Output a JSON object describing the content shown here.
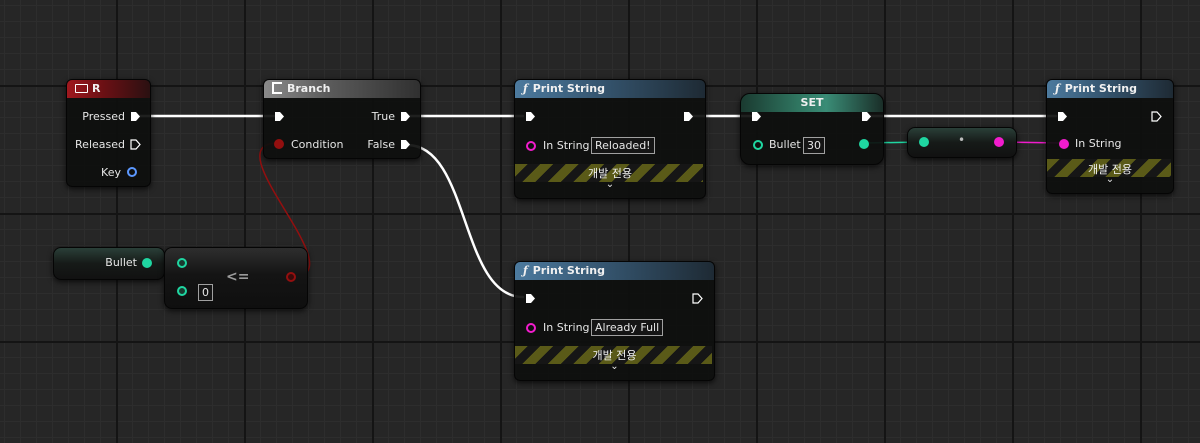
{
  "colors": {
    "exec": "#ffffff",
    "boolean": "#930f0f",
    "integer": "#1fd6a1",
    "string": "#f21ccd",
    "grid": "#262626"
  },
  "icons": {
    "key_event": "keyboard-icon",
    "branch": "branch-icon",
    "function": "function-icon",
    "exec_pin": "exec-pin-icon",
    "data_pin": "data-pin-icon",
    "expand": "chevron-down-icon"
  },
  "key_event": {
    "title": "R",
    "pins": {
      "pressed": "Pressed",
      "released": "Released",
      "key": "Key"
    }
  },
  "branch": {
    "title": "Branch",
    "condition": "Condition",
    "true_label": "True",
    "false_label": "False"
  },
  "print_reloaded": {
    "title": "Print String",
    "in_string_label": "In String",
    "in_string_value": "Reloaded!",
    "dev_only": "개발 전용"
  },
  "set_bullet": {
    "title": "SET",
    "var_label": "Bullet",
    "value": "30"
  },
  "conversion": {
    "dot": "•"
  },
  "print_final": {
    "title": "Print String",
    "in_string_label": "In String",
    "dev_only": "개발 전용"
  },
  "get_bullet": {
    "label": "Bullet"
  },
  "compare": {
    "op": "<=",
    "b_value": "0"
  },
  "print_full": {
    "title": "Print String",
    "in_string_label": "In String",
    "in_string_value": "Already Full",
    "dev_only": "개발 전용"
  }
}
